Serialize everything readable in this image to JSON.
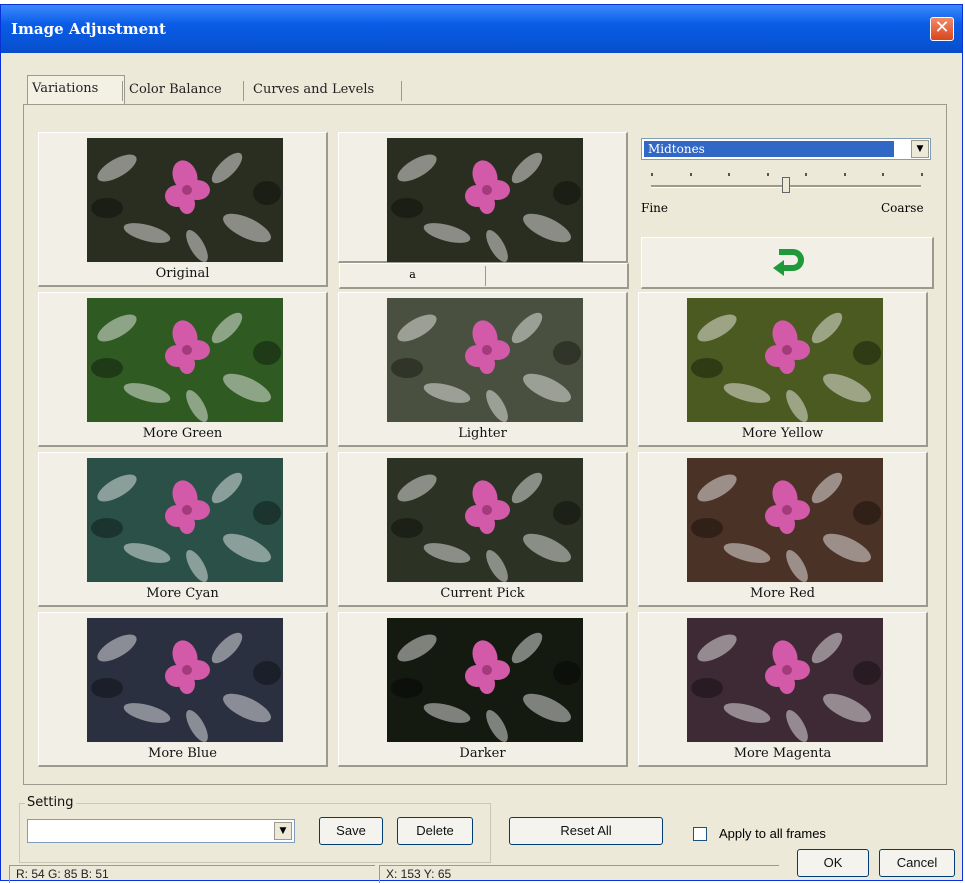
{
  "window": {
    "title": "Image Adjustment"
  },
  "tabs": [
    {
      "label": "Variations"
    },
    {
      "label": "Color Balance"
    },
    {
      "label": "Curves and Levels"
    }
  ],
  "variations": {
    "cells": [
      {
        "label": "Original",
        "tint": "#2a2e20"
      },
      {
        "label": "",
        "tint": "#2a2e20"
      },
      {
        "label": "More Green",
        "tint": "#2f5a22"
      },
      {
        "label": "Lighter",
        "tint": "#4a5040"
      },
      {
        "label": "More Yellow",
        "tint": "#4b5a20"
      },
      {
        "label": "More Cyan",
        "tint": "#2a5048"
      },
      {
        "label": "Current Pick",
        "tint": "#2c3224"
      },
      {
        "label": "More Red",
        "tint": "#4a3226"
      },
      {
        "label": "More Blue",
        "tint": "#2a3040"
      },
      {
        "label": "Darker",
        "tint": "#141a10"
      },
      {
        "label": "More Magenta",
        "tint": "#3e2a34"
      }
    ],
    "pick_bar_marker": "a"
  },
  "range": {
    "selected": "Midtones",
    "slider_level": 0.5,
    "fine_label": "Fine",
    "coarse_label": "Coarse"
  },
  "setting": {
    "group_label": "Setting",
    "combo_value": "",
    "save_label": "Save",
    "delete_label": "Delete"
  },
  "actions": {
    "reset_all": "Reset All",
    "apply_all_frames": "Apply to all frames",
    "ok": "OK",
    "cancel": "Cancel"
  },
  "status": {
    "rgb": "R: 54 G: 85 B: 51",
    "xy": "X: 153   Y: 65"
  },
  "colors": {
    "title_bar": "#0a5ce6",
    "dialog_bg": "#ece9d8",
    "undo_arrow": "#1f9a3a",
    "selection": "#3168c6"
  },
  "icons": {
    "undo": "undo-arrow-icon",
    "close": "close-icon"
  }
}
